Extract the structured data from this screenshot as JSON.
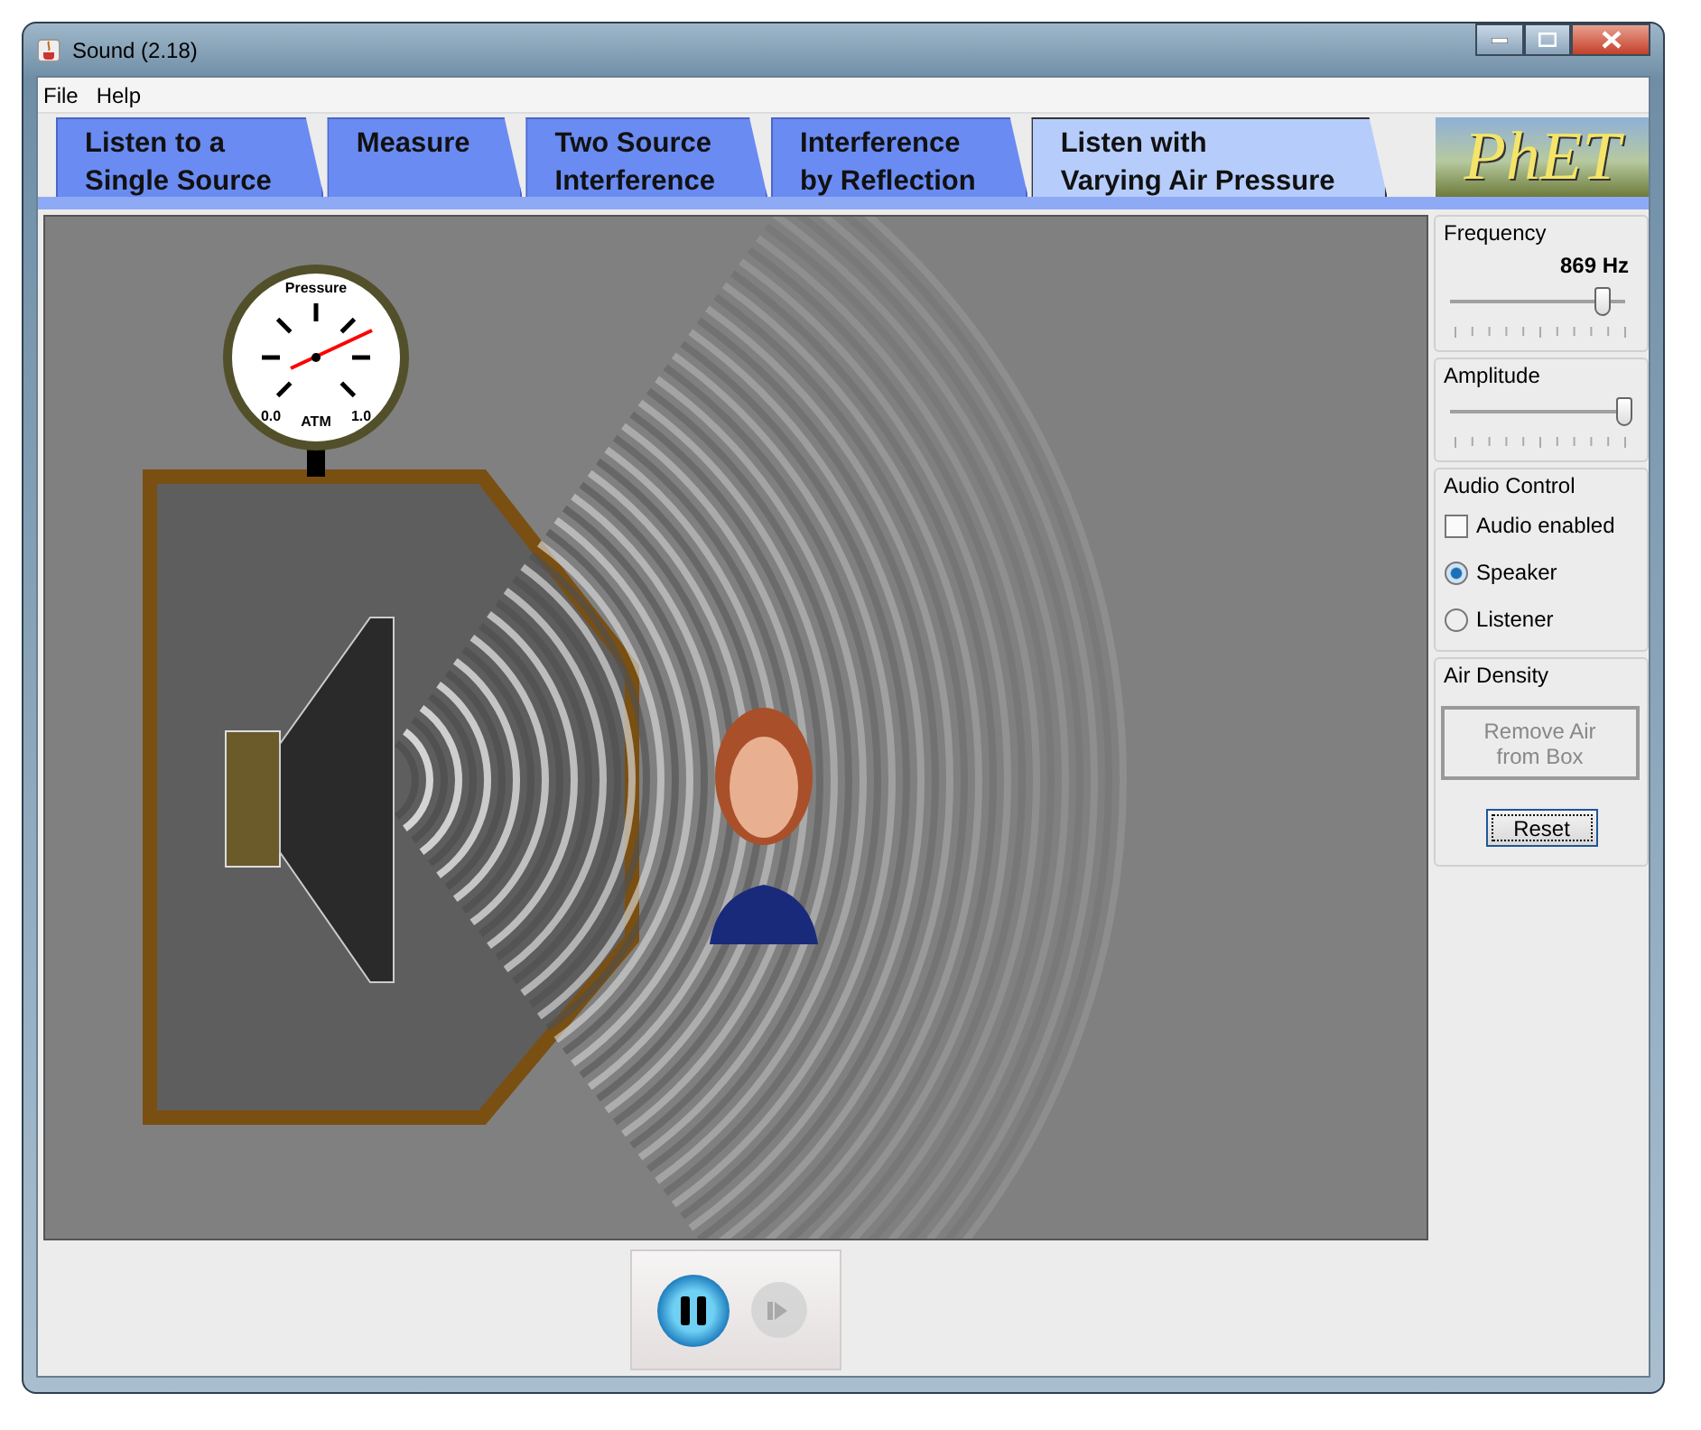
{
  "window": {
    "title": "Sound (2.18)"
  },
  "menu": [
    "File",
    "Help"
  ],
  "tabs": [
    {
      "label": "Listen to a\nSingle Source",
      "selected": false
    },
    {
      "label": "Measure",
      "selected": false
    },
    {
      "label": "Two Source\nInterference",
      "selected": false
    },
    {
      "label": "Interference\nby Reflection",
      "selected": false
    },
    {
      "label": "Listen with\nVarying Air Pressure",
      "selected": true
    }
  ],
  "logo": "PhET",
  "gauge": {
    "title": "Pressure",
    "min_label": "0.0",
    "unit": "ATM",
    "max_label": "1.0"
  },
  "frequency": {
    "title": "Frequency",
    "reading": "869 Hz",
    "level": 0.88
  },
  "amplitude": {
    "title": "Amplitude",
    "level": 1
  },
  "audio_control": {
    "title": "Audio Control",
    "checkbox": {
      "label": "Audio enabled",
      "checked": false
    },
    "radios": [
      {
        "label": "Speaker",
        "selected": true
      },
      {
        "label": "Listener",
        "selected": false
      }
    ]
  },
  "air_density": {
    "title": "Air Density",
    "button": {
      "label": "Remove Air\nfrom Box",
      "disabled": true
    }
  },
  "reset": {
    "label": "Reset"
  },
  "playback": [
    {
      "kind": "pause",
      "disabled": false
    },
    {
      "kind": "step",
      "disabled": true
    }
  ]
}
